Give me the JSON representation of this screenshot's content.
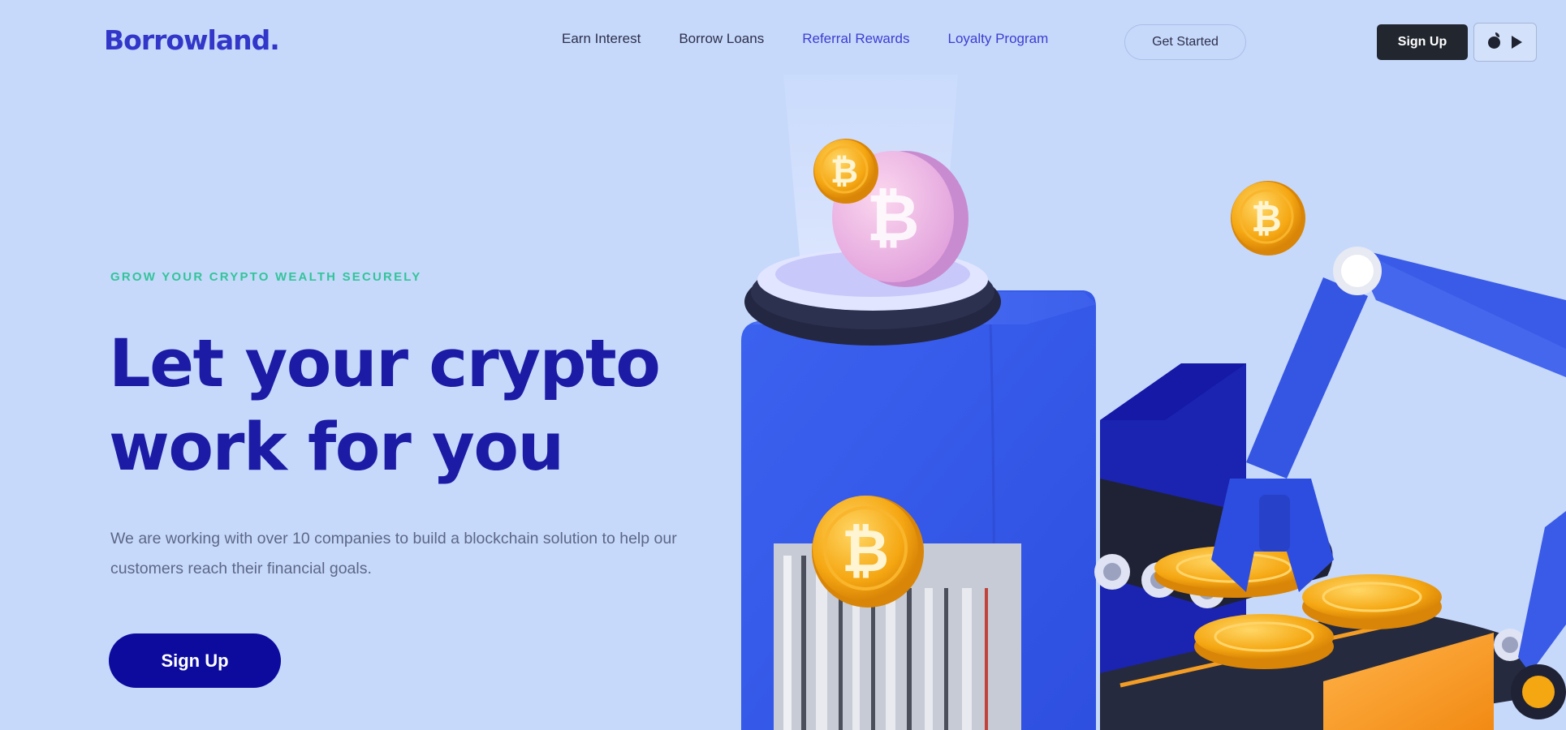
{
  "header": {
    "logo": "Borrowland.",
    "nav_links": [
      "Earn Interest",
      "Borrow Loans",
      "Referral Rewards",
      "Loyalty Program"
    ],
    "get_started_label": "Get Started",
    "signup_label": "Sign Up"
  },
  "hero": {
    "tagline": "GROW YOUR CRYPTO WEALTH SECURELY",
    "headline_line1": "Let your crypto",
    "headline_line2": "work for you",
    "description": "We are working with over 10 companies to build a blockchain solution to help our customers reach their financial goals.",
    "cta_label": "Sign Up"
  },
  "colors": {
    "background": "#c6d9fb",
    "brand": "#3236c9",
    "headline": "#1c1ba5",
    "tagline": "#33c49a",
    "cta": "#0c0b9e"
  },
  "icons": [
    "apple-icon",
    "google-play-icon",
    "bitcoin-coin-icon"
  ]
}
